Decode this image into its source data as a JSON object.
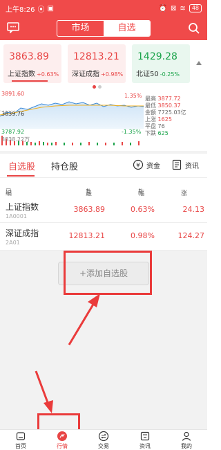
{
  "status_bar": {
    "time": "上午8:26",
    "battery": "48"
  },
  "header": {
    "segments": [
      "市场",
      "自选"
    ],
    "active_segment": "自选"
  },
  "indices": [
    {
      "value": "3863.89",
      "name": "上证指数",
      "change": "+0.63%",
      "trend": "up"
    },
    {
      "value": "12813.21",
      "name": "深证成指",
      "change": "+0.98%",
      "trend": "up"
    },
    {
      "value": "1429.28",
      "name": "北证50",
      "change": "-0.25%",
      "trend": "down"
    }
  ],
  "chart": {
    "high_label": "3891.60",
    "mid_label": "3839.76",
    "low_label": "3787.92",
    "pct_top": "1.35%",
    "pct_bottom": "-1.35%",
    "volume_label": "3838.22万",
    "stats": [
      {
        "label": "最高",
        "value": "3877.72",
        "color": "red"
      },
      {
        "label": "最低",
        "value": "3850.37",
        "color": "red"
      },
      {
        "label": "金额",
        "value": "7725.03亿",
        "color": "normal"
      },
      {
        "label": "上涨",
        "value": "1625",
        "color": "red"
      },
      {
        "label": "平盘",
        "value": "76",
        "color": "normal"
      },
      {
        "label": "下跌",
        "value": "625",
        "color": "green"
      }
    ]
  },
  "tabs": {
    "watchlist": "自选股",
    "holdings": "持仓股",
    "funds": "资金",
    "info": "资讯"
  },
  "list_header": {
    "edit": "编辑",
    "latest": "最新",
    "change_pct": "幅度",
    "change_amt": "涨跌"
  },
  "stocks": [
    {
      "name": "上证指数",
      "code": "1A0001",
      "latest": "3863.89",
      "pct": "0.63%",
      "change": "24.13"
    },
    {
      "name": "深证成指",
      "code": "2A01",
      "latest": "12813.21",
      "pct": "0.98%",
      "change": "124.27"
    }
  ],
  "add_button": "+添加自选股",
  "bottom_nav": [
    "首页",
    "行情",
    "交易",
    "资讯",
    "我的"
  ],
  "active_nav": "行情",
  "colors": {
    "brand_red": "#f04a4a",
    "up": "#e84545",
    "down": "#1aa34a",
    "highlight": "#ea3b3b"
  }
}
